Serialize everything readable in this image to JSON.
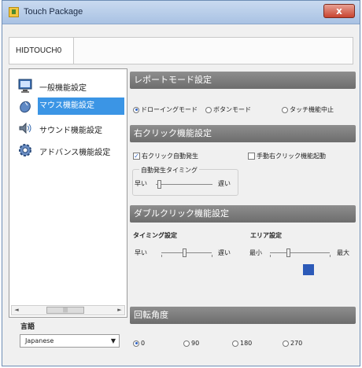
{
  "window": {
    "title": "Touch Package",
    "close_label": "x"
  },
  "device_tab": "HIDTOUCH0",
  "sidebar": {
    "items": [
      {
        "label": "一般機能設定",
        "icon": "monitor-icon"
      },
      {
        "label": "マウス機能設定",
        "icon": "mouse-icon",
        "selected": true
      },
      {
        "label": "サウンド機能設定",
        "icon": "speaker-icon"
      },
      {
        "label": "アドバンス機能設定",
        "icon": "gear-icon"
      }
    ],
    "scroll": {
      "left_arrow": "◄",
      "right_arrow": "►",
      "grip": "|||"
    }
  },
  "language": {
    "label": "言語",
    "value": "Japanese",
    "caret": "▼"
  },
  "report_mode": {
    "header": "レポートモード設定",
    "options": [
      "ドローイングモード",
      "ボタンモード",
      "タッチ機能中止"
    ],
    "selected": 0
  },
  "right_click": {
    "header": "右クリック機能設定",
    "auto_label": "右クリック自動発生",
    "auto_checked": true,
    "manual_label": "手動右クリック機能起動",
    "manual_checked": false,
    "timing_label": "自動発生タイミング",
    "fast": "早い",
    "slow": "遅い",
    "timing_level": 0.05
  },
  "double_click": {
    "header": "ダブルクリック機能設定",
    "timing_label": "タイミング設定",
    "fast": "早い",
    "slow": "遅い",
    "timing_level": 0.45,
    "area_label": "エリア設定",
    "min": "最小",
    "max": "最大",
    "area_level": 0.3,
    "area_color": "#2c5ab8"
  },
  "rotation": {
    "header": "回転角度",
    "options": [
      "0",
      "90",
      "180",
      "270"
    ],
    "selected": 0
  },
  "colors": {
    "selection": "#3b95e5",
    "header_bg": "#7c7c7c",
    "titlebar": "#b8cfea"
  }
}
